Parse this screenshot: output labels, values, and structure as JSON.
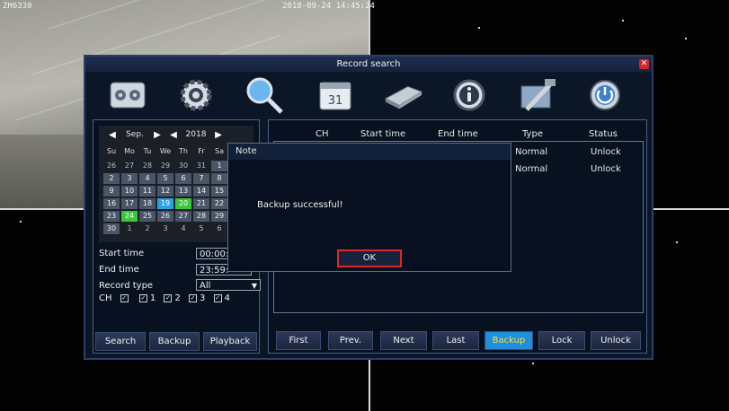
{
  "osd": {
    "channel": "ZH6330",
    "timestamp": "2018-09-24 14:45:24"
  },
  "dialog": {
    "title": "Record search",
    "close_icon": "close-icon",
    "toolbar_icons": [
      "record-config-icon",
      "settings-gear-icon",
      "search-magnifier-icon",
      "calendar-icon",
      "hdd-icon",
      "info-icon",
      "tools-icon",
      "power-icon"
    ]
  },
  "calendar": {
    "month": "Sep.",
    "year": "2018",
    "weekdays": [
      "Su",
      "Mo",
      "Tu",
      "We",
      "Th",
      "Fr",
      "Sa"
    ],
    "days": [
      {
        "d": "26",
        "s": "other"
      },
      {
        "d": "27",
        "s": "other"
      },
      {
        "d": "28",
        "s": "other"
      },
      {
        "d": "29",
        "s": "other"
      },
      {
        "d": "30",
        "s": "other"
      },
      {
        "d": "31",
        "s": "other"
      },
      {
        "d": "1",
        "s": "cur"
      },
      {
        "d": "2",
        "s": "cur"
      },
      {
        "d": "3",
        "s": "cur"
      },
      {
        "d": "4",
        "s": "cur"
      },
      {
        "d": "5",
        "s": "cur"
      },
      {
        "d": "6",
        "s": "cur"
      },
      {
        "d": "7",
        "s": "cur"
      },
      {
        "d": "8",
        "s": "cur"
      },
      {
        "d": "9",
        "s": "cur"
      },
      {
        "d": "10",
        "s": "cur"
      },
      {
        "d": "11",
        "s": "cur"
      },
      {
        "d": "12",
        "s": "cur"
      },
      {
        "d": "13",
        "s": "cur"
      },
      {
        "d": "14",
        "s": "cur"
      },
      {
        "d": "15",
        "s": "cur"
      },
      {
        "d": "16",
        "s": "cur"
      },
      {
        "d": "17",
        "s": "cur"
      },
      {
        "d": "18",
        "s": "cur"
      },
      {
        "d": "19",
        "s": "blue"
      },
      {
        "d": "20",
        "s": "green"
      },
      {
        "d": "21",
        "s": "cur"
      },
      {
        "d": "22",
        "s": "cur"
      },
      {
        "d": "23",
        "s": "cur"
      },
      {
        "d": "24",
        "s": "green"
      },
      {
        "d": "25",
        "s": "cur"
      },
      {
        "d": "26",
        "s": "cur"
      },
      {
        "d": "27",
        "s": "cur"
      },
      {
        "d": "28",
        "s": "cur"
      },
      {
        "d": "29",
        "s": "cur"
      },
      {
        "d": "30",
        "s": "cur"
      },
      {
        "d": "1",
        "s": "other"
      },
      {
        "d": "2",
        "s": "other"
      },
      {
        "d": "3",
        "s": "other"
      },
      {
        "d": "4",
        "s": "other"
      },
      {
        "d": "5",
        "s": "other"
      },
      {
        "d": "6",
        "s": "other"
      }
    ]
  },
  "filters": {
    "start_time_label": "Start time",
    "start_time_value": "00:00:",
    "end_time_label": "End time",
    "end_time_value": "23:59:",
    "record_type_label": "Record type",
    "record_type_value": "All",
    "ch_label": "CH",
    "channels": [
      "1",
      "2",
      "3",
      "4"
    ]
  },
  "left_buttons": [
    "Search",
    "Backup",
    "Playback"
  ],
  "table": {
    "headers": [
      "CH",
      "Start time",
      "End time",
      "Type",
      "Status"
    ],
    "rows": [
      {
        "type": "Normal",
        "status": "Unlock"
      },
      {
        "type": "Normal",
        "status": "Unlock"
      }
    ]
  },
  "bottom_buttons": [
    "First",
    "Prev.",
    "Next",
    "Last",
    "Backup",
    "Lock",
    "Unlock"
  ],
  "active_bottom_button": "Backup",
  "note": {
    "title": "Note",
    "message": "Backup successful!",
    "ok_label": "OK"
  },
  "colors": {
    "accent_blue": "#1e8fdc",
    "record_green": "#3ac83a",
    "selected_blue": "#2aa2e8",
    "close_red": "#d3252c",
    "ok_border": "#e22626"
  }
}
